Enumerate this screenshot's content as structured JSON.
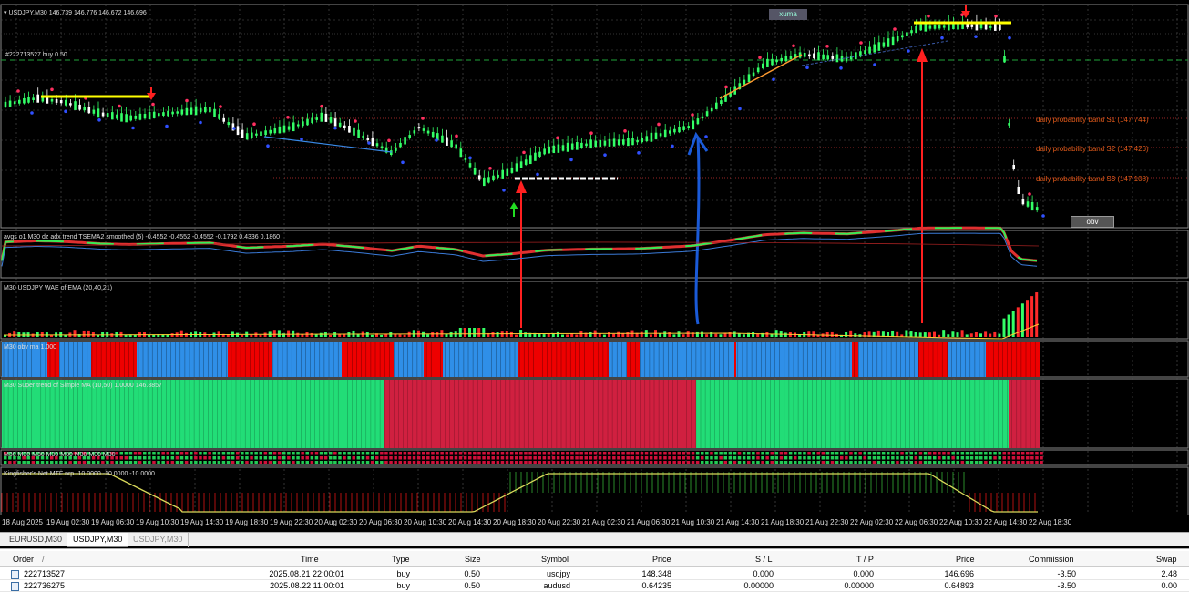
{
  "chart": {
    "symbol_header": "USDJPY,M30  146.739 146.776 146.672 146.696",
    "order_line": "#222713527 buy 0.50",
    "xuma_label": "xuma",
    "obv_button": "obv",
    "bands": [
      "daily probability band S1 (147.744)",
      "daily probability band S2 (147.426)",
      "daily probability band S3 (147.108)"
    ],
    "indicators": {
      "avgs": "avgs o1 M30 dz adx trend TSEMA2 smoothed (5) -0.4552 -0.4552 -0.4552 -0.1792 0.4336 0.1860",
      "wae": "M30 USDJPY WAE of EMA (20,40,21)",
      "obv": "M30 obv ma 1.000",
      "supertrend": "M30  Super trend of   Simple MA (10,50)  1.0000 146.8857",
      "mtf": "M30 M30 M30 M30 M30 M30 M30 M30",
      "kingfisher": "Kingfisher's Net MTF nrp -10.0000 -10.0000 -10.0000"
    },
    "colors": {
      "bull": "#33ff66",
      "bear": "#ff2a2a",
      "obv_blue": "#2f8fe8",
      "supertrend_green": "#22dd77",
      "supertrend_red": "#d02040",
      "arrow_red": "#ff2020",
      "arrow_blue": "#1a5ad8",
      "arrow_green": "#22dd22",
      "band_orange": "#e05a1a",
      "hline_yellow": "#ffff00"
    }
  },
  "xaxis": [
    "18 Aug 2025",
    "19 Aug 02:30",
    "19 Aug 06:30",
    "19 Aug 10:30",
    "19 Aug 14:30",
    "19 Aug 18:30",
    "19 Aug 22:30",
    "20 Aug 02:30",
    "20 Aug 06:30",
    "20 Aug 10:30",
    "20 Aug 14:30",
    "20 Aug 18:30",
    "20 Aug 22:30",
    "21 Aug 02:30",
    "21 Aug 06:30",
    "21 Aug 10:30",
    "21 Aug 14:30",
    "21 Aug 18:30",
    "21 Aug 22:30",
    "22 Aug 02:30",
    "22 Aug 06:30",
    "22 Aug 10:30",
    "22 Aug 14:30",
    "22 Aug 18:30"
  ],
  "tabs": [
    {
      "label": "EURUSD,M30",
      "state": "normal"
    },
    {
      "label": "USDJPY,M30",
      "state": "active"
    },
    {
      "label": "USDJPY,M30",
      "state": "muted"
    }
  ],
  "table": {
    "headers": [
      "Order",
      "/",
      "Time",
      "Type",
      "Size",
      "Symbol",
      "Price",
      "S / L",
      "T / P",
      "Price",
      "Commission",
      "Swap"
    ],
    "rows": [
      {
        "order": "222713527",
        "time": "2025.08.21 22:00:01",
        "type": "buy",
        "size": "0.50",
        "symbol": "usdjpy",
        "price": "148.348",
        "sl": "0.000",
        "tp": "0.000",
        "cur_price": "146.696",
        "commission": "-3.50",
        "swap": "2.48"
      },
      {
        "order": "222736275",
        "time": "2025.08.22 11:00:01",
        "type": "buy",
        "size": "0.50",
        "symbol": "audusd",
        "price": "0.64235",
        "sl": "0.00000",
        "tp": "0.00000",
        "cur_price": "0.64893",
        "commission": "-3.50",
        "swap": "0.00"
      }
    ]
  }
}
